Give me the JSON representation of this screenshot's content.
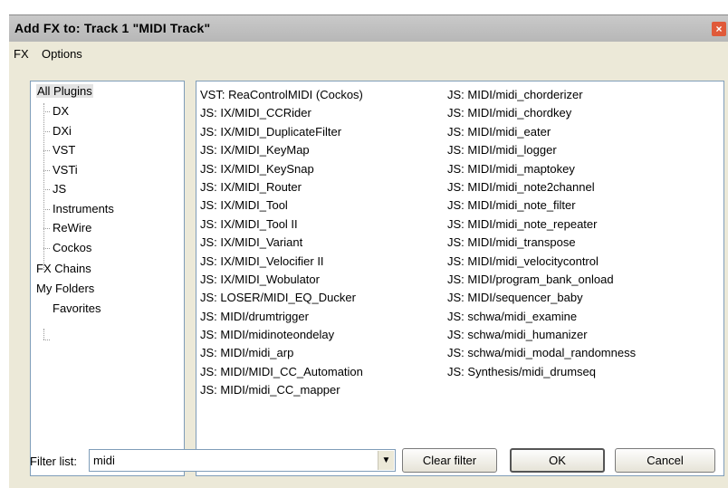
{
  "window": {
    "title": "Add FX to: Track 1 \"MIDI Track\"",
    "close_glyph": "×"
  },
  "menu": [
    "FX",
    "Options"
  ],
  "tree": {
    "all_plugins": "All Plugins",
    "children": [
      "DX",
      "DXi",
      "VST",
      "VSTi",
      "JS",
      "Instruments",
      "ReWire",
      "Cockos"
    ],
    "fx_chains": "FX Chains",
    "my_folders": "My Folders",
    "favorites": "Favorites"
  },
  "plugins": {
    "column1": [
      "VST: ReaControlMIDI (Cockos)",
      "JS: IX/MIDI_CCRider",
      "JS: IX/MIDI_DuplicateFilter",
      "JS: IX/MIDI_KeyMap",
      "JS: IX/MIDI_KeySnap",
      "JS: IX/MIDI_Router",
      "JS: IX/MIDI_Tool",
      "JS: IX/MIDI_Tool II",
      "JS: IX/MIDI_Variant",
      "JS: IX/MIDI_Velocifier II",
      "JS: IX/MIDI_Wobulator",
      "JS: LOSER/MIDI_EQ_Ducker",
      "JS: MIDI/drumtrigger",
      "JS: MIDI/midinoteondelay",
      "JS: MIDI/midi_arp",
      "JS: MIDI/MIDI_CC_Automation",
      "JS: MIDI/midi_CC_mapper"
    ],
    "column2": [
      "JS: MIDI/midi_chorderizer",
      "JS: MIDI/midi_chordkey",
      "JS: MIDI/midi_eater",
      "JS: MIDI/midi_logger",
      "JS: MIDI/midi_maptokey",
      "JS: MIDI/midi_note2channel",
      "JS: MIDI/midi_note_filter",
      "JS: MIDI/midi_note_repeater",
      "JS: MIDI/midi_transpose",
      "JS: MIDI/midi_velocitycontrol",
      "JS: MIDI/program_bank_onload",
      "JS: MIDI/sequencer_baby",
      "JS: schwa/midi_examine",
      "JS: schwa/midi_humanizer",
      "JS: schwa/midi_modal_randomness",
      "JS: Synthesis/midi_drumseq"
    ]
  },
  "filter": {
    "label": "Filter list:",
    "value": "midi",
    "dropdown_glyph": "▼"
  },
  "buttons": {
    "clear_filter": "Clear filter",
    "ok": "OK",
    "cancel": "Cancel"
  }
}
